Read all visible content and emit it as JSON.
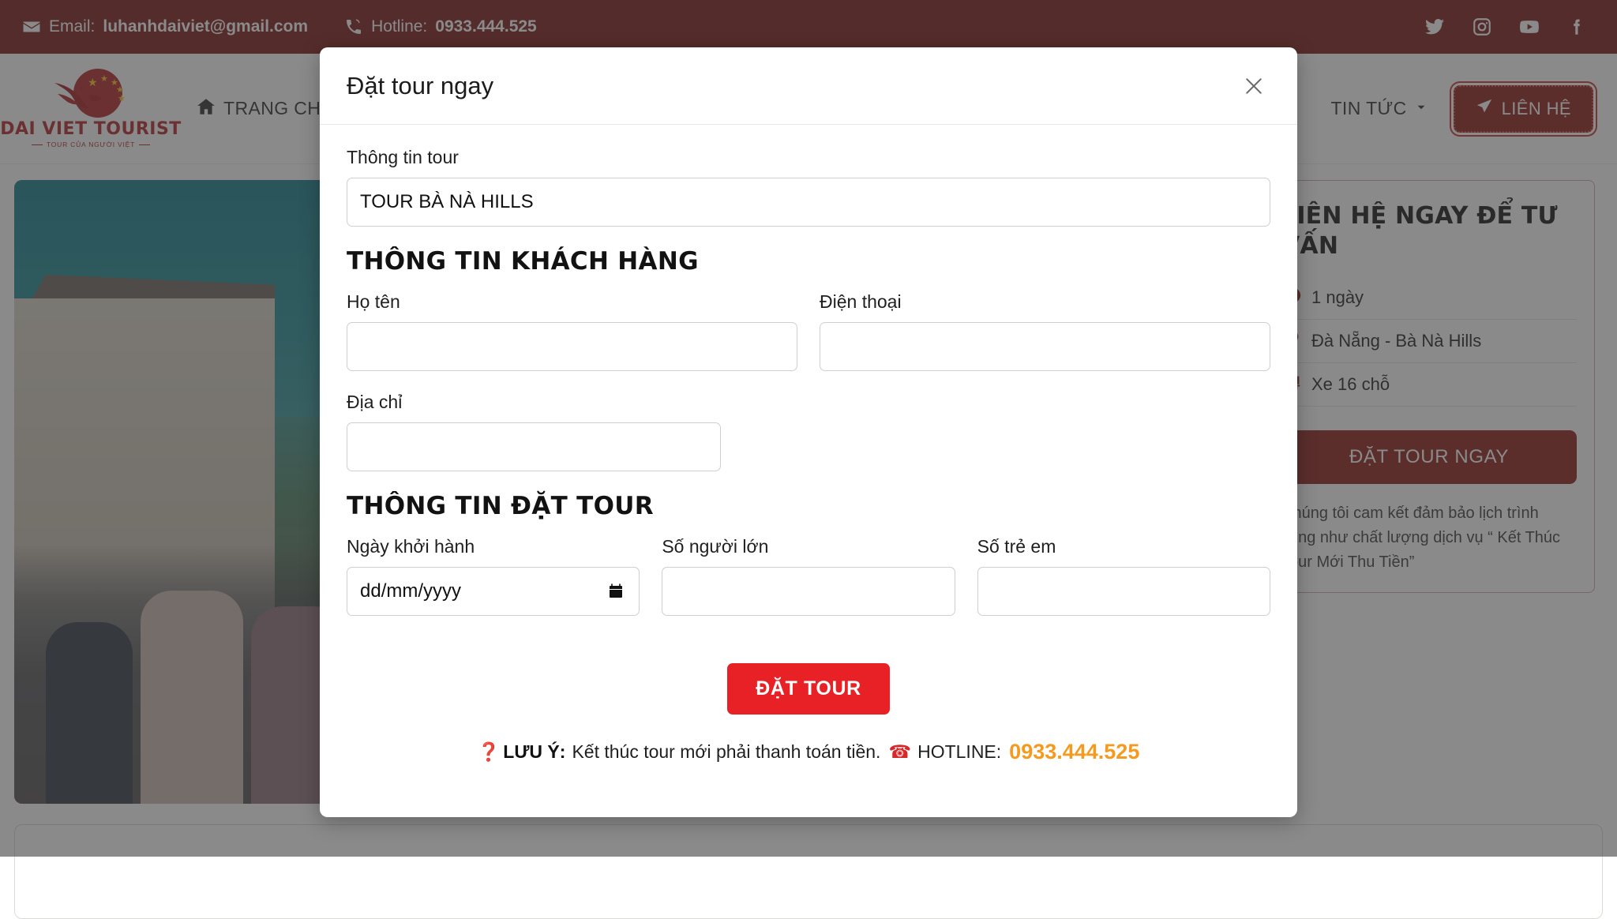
{
  "topbar": {
    "email_label": "Email:",
    "email_value": "luhanhdaiviet@gmail.com",
    "hotline_label": "Hotline:",
    "hotline_value": "0933.444.525",
    "social": [
      {
        "name": "twitter-icon"
      },
      {
        "name": "instagram-icon"
      },
      {
        "name": "youtube-icon"
      },
      {
        "name": "facebook-icon"
      }
    ],
    "bar_color": "#791512"
  },
  "header": {
    "logo_word": "DAI VIET TOURIST",
    "logo_tagline": "TOUR CỦA NGƯỜI VIỆT",
    "nav": [
      {
        "label": "TRANG CHỦ",
        "icon": "home-icon"
      },
      {
        "label": "TIN TỨC",
        "icon": "chevron-down-icon"
      }
    ],
    "contact_button": "LIÊN HỆ",
    "brand_color": "#8b1a16"
  },
  "sidebar": {
    "title": "LIÊN HỆ NGAY ĐỂ TƯ VẤN",
    "rows": [
      {
        "icon": "clock-icon",
        "text": "1 ngày"
      },
      {
        "icon": "map-pin-icon",
        "text": "Đà Nẵng - Bà Nà Hills"
      },
      {
        "icon": "bus-icon",
        "text": "Xe 16 chỗ"
      }
    ],
    "book_button": "ĐẶT TOUR NGAY",
    "note": "Chúng tôi cam kết đảm bảo lịch trình cũng như chất lượng dịch vụ “ Kết Thúc Tour Mới Thu Tiền”"
  },
  "modal": {
    "title": "Đặt tour ngay",
    "close_icon": "close-icon",
    "tour_info": {
      "label": "Thông tin tour",
      "value": "TOUR BÀ NÀ HILLS"
    },
    "customer_section": {
      "title": "THÔNG TIN KHÁCH HÀNG",
      "fields": [
        {
          "label": "Họ tên",
          "value": "",
          "placeholder": ""
        },
        {
          "label": "Điện thoại",
          "value": "",
          "placeholder": ""
        },
        {
          "label": "Địa chỉ",
          "value": "",
          "placeholder": ""
        }
      ]
    },
    "booking_section": {
      "title": "THÔNG TIN ĐẶT TOUR",
      "fields": [
        {
          "label": "Ngày khởi hành",
          "value": "",
          "placeholder": "dd/mm/yyyy"
        },
        {
          "label": "Số người lớn",
          "value": "",
          "placeholder": ""
        },
        {
          "label": "Số trẻ em",
          "value": "",
          "placeholder": ""
        }
      ]
    },
    "submit_button": "ĐẶT TOUR",
    "footer": {
      "question_mark": "❓",
      "note_label": "LƯU Ý:",
      "note_text": "Kết thúc tour mới phải thanh toán tiền.",
      "phone_icon": "☎",
      "hotline_label": "HOTLINE:",
      "hotline_value": "0933.444.525",
      "accent_color": "#f59a1e"
    },
    "submit_color": "#e82127"
  }
}
